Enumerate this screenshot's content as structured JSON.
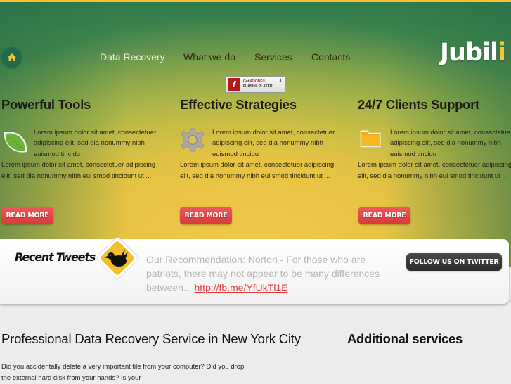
{
  "brand": {
    "logo_text": "Jubil",
    "logo_accent": "i"
  },
  "nav": {
    "home_icon": "home-icon",
    "items": [
      {
        "label": "Data Recovery",
        "active": true
      },
      {
        "label": "What we do",
        "active": false
      },
      {
        "label": "Services",
        "active": false
      },
      {
        "label": "Contacts",
        "active": false
      }
    ]
  },
  "flash_badge": {
    "line1_prefix": "Get ",
    "line1_brand": "ADOBE®",
    "line2": "FLASH® PLAYER",
    "icon": "flash-icon"
  },
  "features": [
    {
      "title": "Powerful Tools",
      "icon": "leaf-icon",
      "intro": "Lorem ipsum dolor sit amet, consectetuer adipiscing elit, sed dia nonummy nibh euismod tincidu",
      "body": "Lorem ipsum dolor sit amet, consectetuer adipiscing elit, sed dia nonummy nibh eui smod tincidunt ut ...",
      "button": "READ MORE"
    },
    {
      "title": "Effective Strategies",
      "icon": "gear-icon",
      "intro": "Lorem ipsum dolor sit amet, consectetuer adipiscing elit, sed dia nonummy nibh euismod tincidu",
      "body": "Lorem ipsum dolor sit amet, consectetuer adipiscing elit, sed dia nonummy nibh eui smod tincidunt ut ...",
      "button": "READ MORE"
    },
    {
      "title": "24/7 Clients Support",
      "icon": "folder-icon",
      "intro": "Lorem ipsum dolor sit amet, consectetuer adipiscing elit, sed dia nonummy nibh euismod tincidu",
      "body": "Lorem ipsum dolor sit amet, consectetuer adipiscing elit, sed dia nonummy nibh eui smod tincidunt ut ...",
      "button": "READ MORE"
    }
  ],
  "tweets": {
    "title": "Recent Tweets",
    "text": "Our Recommendation: Norton - For those who are patriots, there may not appear to be many differences between... ",
    "link": "http://fb.me/YfUkTl1E",
    "follow_button": "FOLLOW US ON TWITTER"
  },
  "main": {
    "title": "Professional Data Recovery Service in New York City",
    "body": "Did you accidentally delete a very important file from your computer? Did you drop the external hard disk from your hands? Is your"
  },
  "sidebar": {
    "title": "Additional services"
  },
  "colors": {
    "accent_red": "#e04444",
    "brand_yellow": "#f2c53a",
    "deep_green": "#1f6b4c"
  }
}
